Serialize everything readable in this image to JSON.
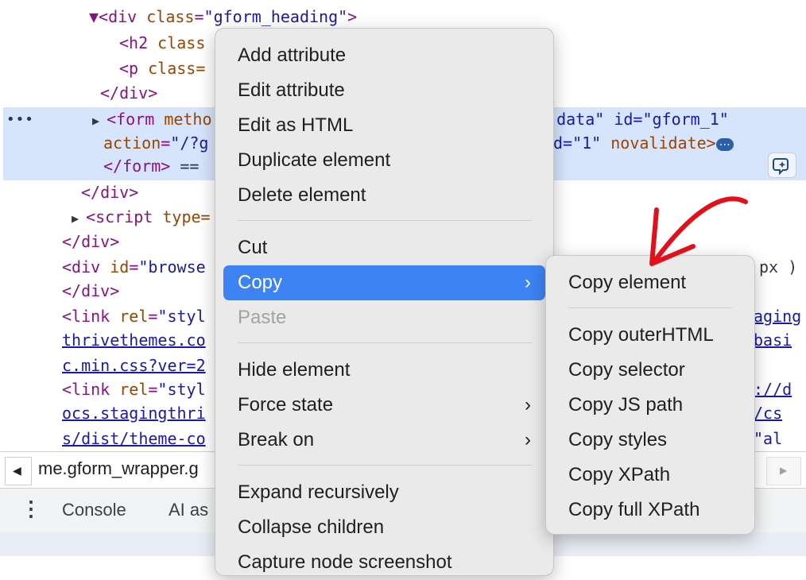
{
  "elements_panel": {
    "lines": [
      {
        "parts": [
          {
            "c": "tag",
            "t": "▼"
          },
          {
            "c": "tag",
            "t": "<div "
          },
          {
            "c": "attr",
            "t": "class"
          },
          {
            "c": "tag",
            "t": "="
          },
          {
            "c": "val",
            "t": "\"gform_heading\""
          },
          {
            "c": "tag",
            "t": ">"
          }
        ]
      },
      {
        "parts": [
          {
            "c": "tag",
            "t": "<h2 "
          },
          {
            "c": "attr",
            "t": "class"
          }
        ]
      },
      {
        "parts": [
          {
            "c": "tag",
            "t": "<p "
          },
          {
            "c": "attr",
            "t": "class="
          }
        ]
      },
      {
        "parts": [
          {
            "c": "tag",
            "t": "</div>"
          }
        ]
      },
      {
        "parts": [
          {
            "c": "tag",
            "t": "<form "
          },
          {
            "c": "attr",
            "t": "metho"
          }
        ]
      },
      {
        "parts": [
          {
            "c": "attr",
            "t": "action"
          },
          {
            "c": "tag",
            "t": "="
          },
          {
            "c": "val",
            "t": "\"/?g"
          }
        ]
      },
      {
        "parts": [
          {
            "c": "tag",
            "t": "</form>"
          },
          {
            "c": "plain",
            "t": " == "
          }
        ]
      },
      {
        "parts": [
          {
            "c": "tag",
            "t": "</div>"
          }
        ]
      },
      {
        "parts": [
          {
            "c": "tag",
            "t": "<script "
          },
          {
            "c": "attr",
            "t": "type="
          }
        ]
      },
      {
        "parts": [
          {
            "c": "tag",
            "t": "</div>"
          }
        ]
      },
      {
        "parts": [
          {
            "c": "tag",
            "t": "<div "
          },
          {
            "c": "attr",
            "t": "id"
          },
          {
            "c": "tag",
            "t": "="
          },
          {
            "c": "val",
            "t": "\"browse"
          }
        ]
      },
      {
        "parts": [
          {
            "c": "tag",
            "t": "</div>"
          }
        ]
      },
      {
        "parts": [
          {
            "c": "tag",
            "t": "<link "
          },
          {
            "c": "attr",
            "t": "rel"
          },
          {
            "c": "tag",
            "t": "="
          },
          {
            "c": "val",
            "t": "\"styl"
          }
        ]
      },
      {
        "parts": [
          {
            "c": "link",
            "t": "thrivethemes.co"
          }
        ]
      },
      {
        "parts": [
          {
            "c": "link",
            "t": "c.min.css?ver=2"
          }
        ]
      },
      {
        "parts": [
          {
            "c": "tag",
            "t": "<link "
          },
          {
            "c": "attr",
            "t": "rel"
          },
          {
            "c": "tag",
            "t": "="
          },
          {
            "c": "val",
            "t": "\"styl"
          }
        ]
      },
      {
        "parts": [
          {
            "c": "link",
            "t": "ocs.stagingthri"
          }
        ]
      },
      {
        "parts": [
          {
            "c": "link",
            "t": "s/dist/theme-co"
          }
        ]
      }
    ],
    "right_fragments": {
      "form_line": "n-data\" id=\"gform_1\"",
      "form_line2_a": "d=\"1\"",
      "form_line2_b": " novalidate>",
      "browse_end": "px )",
      "link1_end": "aging",
      "link1_end2": "basi",
      "link2_end": "://d",
      "link2_end2": "/cs",
      "link2_end3": "\"al"
    },
    "selection_dots": "•••",
    "ellipsis_badge": "…"
  },
  "breadcrumb": {
    "text": "me.gform_wrapper.g"
  },
  "drawer": {
    "tabs": [
      "Console",
      "AI as"
    ]
  },
  "context_menu": {
    "items": [
      {
        "label": "Add attribute"
      },
      {
        "label": "Edit attribute"
      },
      {
        "label": "Edit as HTML"
      },
      {
        "label": "Duplicate element"
      },
      {
        "label": "Delete element"
      },
      {
        "label": "Cut"
      },
      {
        "label": "Copy",
        "submenu": true,
        "active": true
      },
      {
        "label": "Paste",
        "disabled": true
      },
      {
        "label": "Hide element"
      },
      {
        "label": "Force state",
        "submenu": true
      },
      {
        "label": "Break on",
        "submenu": true
      },
      {
        "label": "Expand recursively"
      },
      {
        "label": "Collapse children"
      },
      {
        "label": "Capture node screenshot"
      }
    ]
  },
  "copy_submenu": {
    "items": [
      {
        "label": "Copy element"
      },
      {
        "label": "Copy outerHTML"
      },
      {
        "label": "Copy selector"
      },
      {
        "label": "Copy JS path"
      },
      {
        "label": "Copy styles"
      },
      {
        "label": "Copy XPath"
      },
      {
        "label": "Copy full XPath"
      }
    ]
  },
  "icons": {
    "submenu_chevron": "›",
    "left_arrow": "◀",
    "right_arrow": "▶",
    "kebab": "⋮",
    "expand_triangle": "▶",
    "expanded_triangle": "▼"
  },
  "colors": {
    "selection": "#d6e4fc",
    "menu_active": "#3d83f3",
    "annotation_arrow": "#e3101b"
  }
}
